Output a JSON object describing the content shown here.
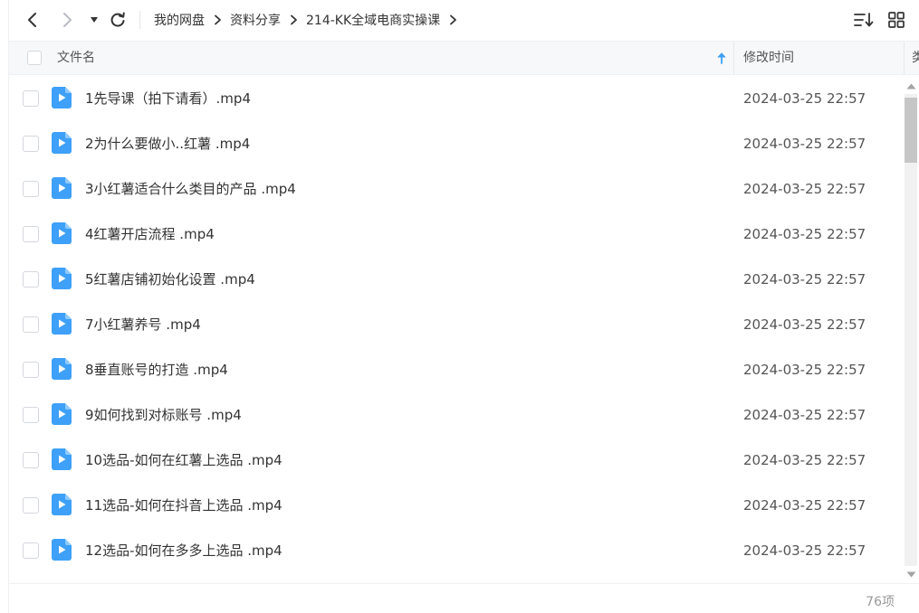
{
  "toolbar": {
    "breadcrumb": [
      "我的网盘",
      "资料分享",
      "214-KK全域电商实操课"
    ],
    "icons": {
      "back": "chevron-left-icon",
      "forward": "chevron-right-icon",
      "history": "caret-down-icon",
      "refresh": "refresh-icon",
      "sort": "sort-list-icon",
      "grid_view": "grid-view-icon"
    }
  },
  "header": {
    "name": "文件名",
    "modified": "修改时间",
    "type": "类"
  },
  "accent_color": "#3ea0f8",
  "files": [
    {
      "name": "1先导课（拍下请看）.mp4",
      "time": "2024-03-25 22:57"
    },
    {
      "name": "2为什么要做小..红薯 .mp4",
      "time": "2024-03-25 22:57"
    },
    {
      "name": "3小红薯适合什么类目的产品 .mp4",
      "time": "2024-03-25 22:57"
    },
    {
      "name": "4红薯开店流程 .mp4",
      "time": "2024-03-25 22:57"
    },
    {
      "name": "5红薯店铺初始化设置 .mp4",
      "time": "2024-03-25 22:57"
    },
    {
      "name": "7小红薯养号 .mp4",
      "time": "2024-03-25 22:57"
    },
    {
      "name": "8垂直账号的打造 .mp4",
      "time": "2024-03-25 22:57"
    },
    {
      "name": "9如何找到对标账号 .mp4",
      "time": "2024-03-25 22:57"
    },
    {
      "name": "10选品-如何在红薯上选品 .mp4",
      "time": "2024-03-25 22:57"
    },
    {
      "name": "11选品-如何在抖音上选品 .mp4",
      "time": "2024-03-25 22:57"
    },
    {
      "name": "12选品-如何在多多上选品 .mp4",
      "time": "2024-03-25 22:57"
    }
  ],
  "footer": {
    "count": "76项"
  }
}
